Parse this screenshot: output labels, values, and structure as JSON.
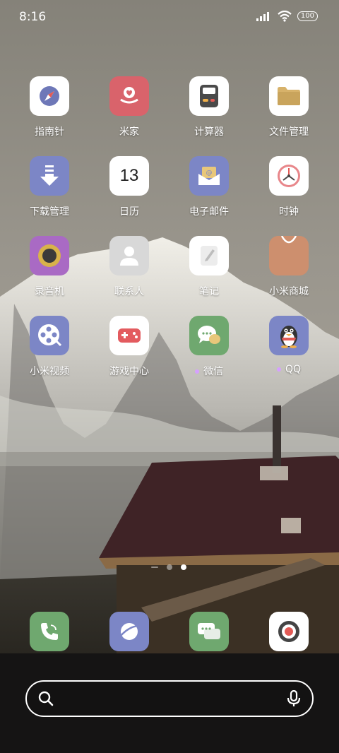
{
  "status_bar": {
    "time": "8:16",
    "battery": "100"
  },
  "apps": [
    {
      "name": "compass",
      "label": "指南针",
      "bg": "#ffffff",
      "icon": "compass-icon"
    },
    {
      "name": "mi-home",
      "label": "米家",
      "bg": "#d9636b",
      "icon": "heart-hand-icon"
    },
    {
      "name": "calculator",
      "label": "计算器",
      "bg": "#ffffff",
      "icon": "calculator-icon"
    },
    {
      "name": "file-manager",
      "label": "文件管理",
      "bg": "#ffffff",
      "icon": "folder-icon"
    },
    {
      "name": "downloads",
      "label": "下载管理",
      "bg": "#7c86c6",
      "icon": "download-arrow-icon"
    },
    {
      "name": "calendar",
      "label": "日历",
      "bg": "#ffffff",
      "icon": "calendar-icon",
      "day": "13"
    },
    {
      "name": "email",
      "label": "电子邮件",
      "bg": "#7c86c6",
      "icon": "mail-icon"
    },
    {
      "name": "clock",
      "label": "时钟",
      "bg": "#ffffff",
      "icon": "clock-icon"
    },
    {
      "name": "recorder",
      "label": "录音机",
      "bg": "#a96ac4",
      "icon": "record-disc-icon"
    },
    {
      "name": "contacts",
      "label": "联系人",
      "bg": "#d8d8d8",
      "icon": "person-icon"
    },
    {
      "name": "notes",
      "label": "笔记",
      "bg": "#ffffff",
      "icon": "note-pen-icon"
    },
    {
      "name": "mi-store",
      "label": "小米商城",
      "bg": "#cd8f6e",
      "icon": "shopping-bag-icon"
    },
    {
      "name": "mi-video",
      "label": "小米视频",
      "bg": "#7c86c6",
      "icon": "film-reel-icon"
    },
    {
      "name": "game-center",
      "label": "游戏中心",
      "bg": "#ffffff",
      "icon": "gamepad-icon"
    },
    {
      "name": "wechat",
      "label": "微信",
      "bg": "#6fa86f",
      "icon": "chat-bubbles-icon",
      "new_dot": true
    },
    {
      "name": "qq",
      "label": "QQ",
      "bg": "#7c86c6",
      "icon": "penguin-icon",
      "new_dot": true
    }
  ],
  "dock": [
    {
      "name": "phone",
      "bg": "#6fa86f",
      "icon": "phone-icon"
    },
    {
      "name": "browser",
      "bg": "#7c86c6",
      "icon": "planet-icon"
    },
    {
      "name": "messages",
      "bg": "#6fa86f",
      "icon": "message-bubbles-icon"
    },
    {
      "name": "camera",
      "bg": "#ffffff",
      "icon": "camera-lens-icon"
    }
  ],
  "pager": {
    "pages": 2,
    "active_index": 1
  },
  "search": {
    "icon": "search-icon",
    "mic_icon": "microphone-icon"
  }
}
